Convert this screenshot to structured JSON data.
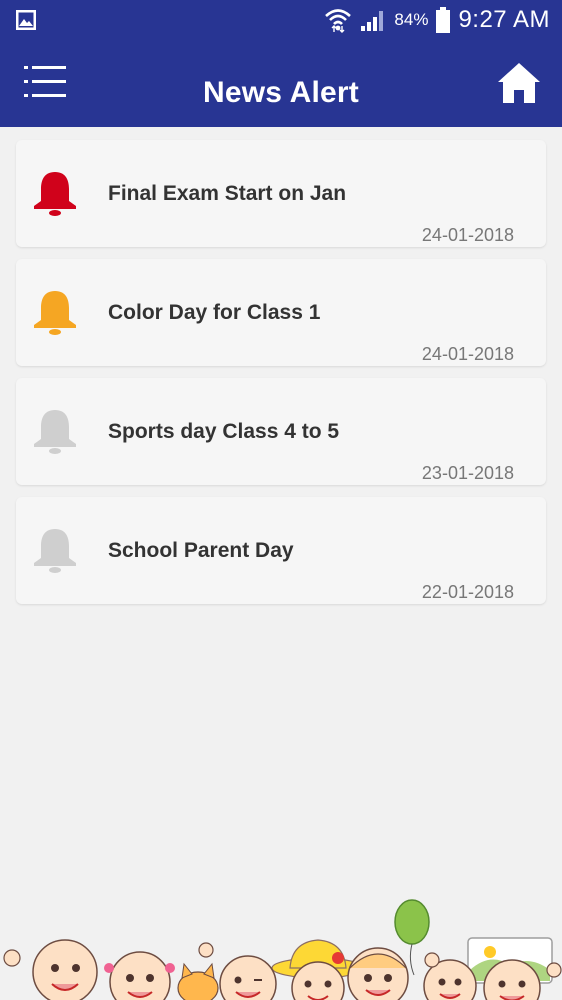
{
  "status_bar": {
    "battery": "84%",
    "time": "9:27 AM",
    "left_icon": "gallery-icon",
    "icons": [
      "wifi-icon",
      "signal-icon",
      "battery-icon"
    ]
  },
  "header": {
    "title": "News Alert",
    "menu_icon": "menu-icon",
    "home_icon": "home-icon",
    "background": "#283593"
  },
  "alerts": [
    {
      "title": "Final Exam Start on Jan",
      "date": "24-01-2018",
      "bell_color": "#d0021b"
    },
    {
      "title": "Color Day for Class 1",
      "date": "24-01-2018",
      "bell_color": "#f5a623"
    },
    {
      "title": "Sports day Class 4 to 5",
      "date": "23-01-2018",
      "bell_color": "#cfcfcf"
    },
    {
      "title": "School Parent Day",
      "date": "22-01-2018",
      "bell_color": "#cfcfcf"
    }
  ],
  "footer": {
    "illustration": "children-cartoon-banner"
  }
}
